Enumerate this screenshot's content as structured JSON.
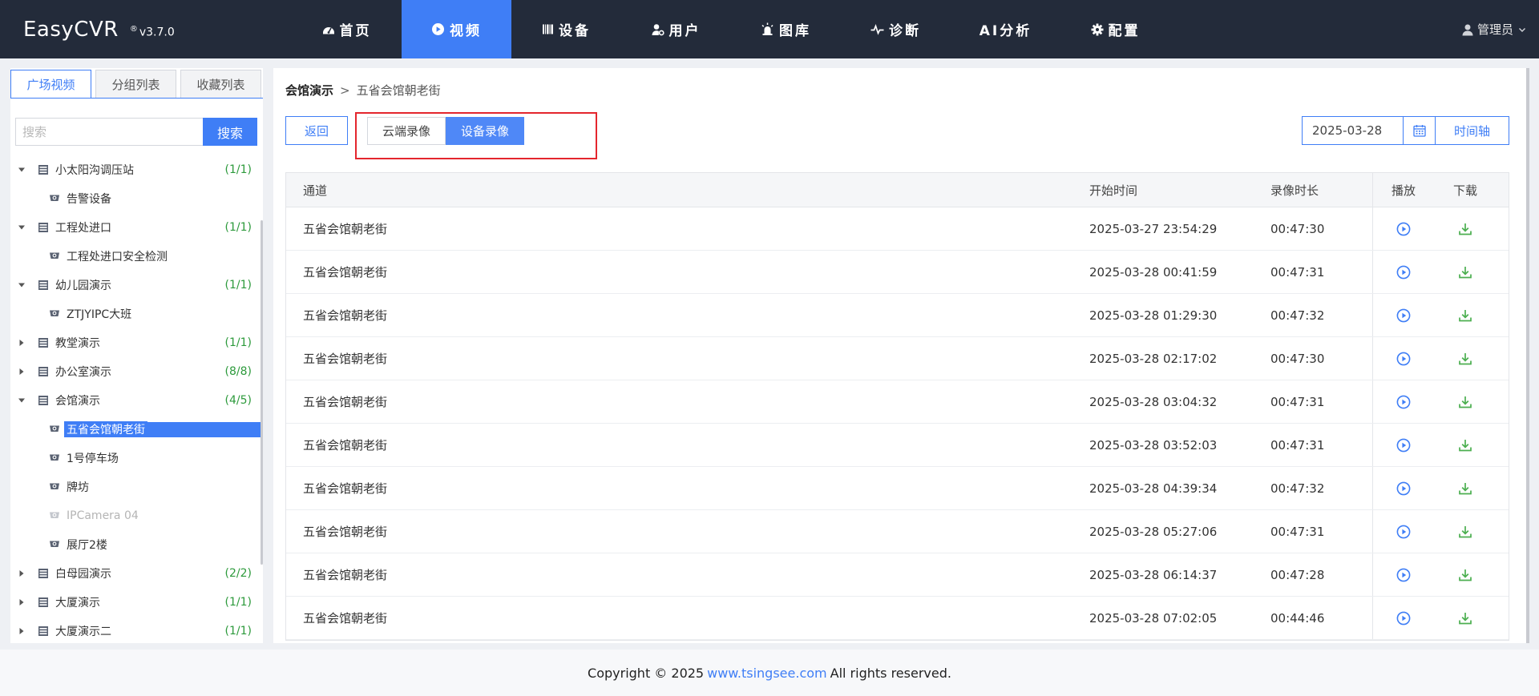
{
  "app": {
    "name": "EasyCVR",
    "version_mark": "®",
    "version": "v3.7.0"
  },
  "nav": [
    {
      "label": "首页",
      "icon": "dashboard-icon"
    },
    {
      "label": "视频",
      "icon": "play-circle-icon",
      "active": true
    },
    {
      "label": "设备",
      "icon": "barcode-icon"
    },
    {
      "label": "用户",
      "icon": "user-cog-icon"
    },
    {
      "label": "图库",
      "icon": "alarm-icon"
    },
    {
      "label": "诊断",
      "icon": "pulse-icon"
    },
    {
      "label": "AI分析",
      "icon": ""
    },
    {
      "label": "配置",
      "icon": "gear-icon"
    }
  ],
  "user": {
    "name": "管理员"
  },
  "sidebar": {
    "tabs": [
      "广场视频",
      "分组列表",
      "收藏列表"
    ],
    "search_placeholder": "搜索",
    "search_button": "搜索",
    "tree": [
      {
        "type": "group",
        "label": "小太阳沟调压站",
        "count": "(1/1)",
        "expanded": true
      },
      {
        "type": "cam",
        "label": "告警设备"
      },
      {
        "type": "group",
        "label": "工程处进口",
        "count": "(1/1)",
        "expanded": true
      },
      {
        "type": "cam",
        "label": "工程处进口安全检测"
      },
      {
        "type": "group",
        "label": "幼儿园演示",
        "count": "(1/1)",
        "expanded": true
      },
      {
        "type": "cam",
        "label": "ZTJYIPC大班"
      },
      {
        "type": "group",
        "label": "教堂演示",
        "count": "(1/1)",
        "expanded": false
      },
      {
        "type": "group",
        "label": "办公室演示",
        "count": "(8/8)",
        "expanded": false
      },
      {
        "type": "group",
        "label": "会馆演示",
        "count": "(4/5)",
        "expanded": true
      },
      {
        "type": "cam",
        "label": "五省会馆朝老街",
        "selected": true
      },
      {
        "type": "cam",
        "label": "1号停车场"
      },
      {
        "type": "cam",
        "label": "牌坊"
      },
      {
        "type": "cam",
        "label": "IPCamera 04",
        "offline": true
      },
      {
        "type": "cam",
        "label": "展厅2楼"
      },
      {
        "type": "group",
        "label": "白母园演示",
        "count": "(2/2)",
        "expanded": false
      },
      {
        "type": "group",
        "label": "大厦演示",
        "count": "(1/1)",
        "expanded": false
      },
      {
        "type": "group",
        "label": "大厦演示二",
        "count": "(1/1)",
        "expanded": false
      }
    ]
  },
  "main": {
    "breadcrumb": {
      "parent": "会馆演示",
      "separator": ">",
      "current": "五省会馆朝老街"
    },
    "back_button": "返回",
    "segments": [
      {
        "label": "云端录像"
      },
      {
        "label": "设备录像",
        "active": true
      }
    ],
    "date_value": "2025-03-28",
    "timeline_button": "时间轴",
    "table": {
      "headers": {
        "channel": "通道",
        "start": "开始时间",
        "duration": "录像时长",
        "play": "播放",
        "download": "下载"
      },
      "rows": [
        {
          "channel": "五省会馆朝老街",
          "start": "2025-03-27 23:54:29",
          "duration": "00:47:30"
        },
        {
          "channel": "五省会馆朝老街",
          "start": "2025-03-28 00:41:59",
          "duration": "00:47:31"
        },
        {
          "channel": "五省会馆朝老街",
          "start": "2025-03-28 01:29:30",
          "duration": "00:47:32"
        },
        {
          "channel": "五省会馆朝老街",
          "start": "2025-03-28 02:17:02",
          "duration": "00:47:30"
        },
        {
          "channel": "五省会馆朝老街",
          "start": "2025-03-28 03:04:32",
          "duration": "00:47:31"
        },
        {
          "channel": "五省会馆朝老街",
          "start": "2025-03-28 03:52:03",
          "duration": "00:47:31"
        },
        {
          "channel": "五省会馆朝老街",
          "start": "2025-03-28 04:39:34",
          "duration": "00:47:32"
        },
        {
          "channel": "五省会馆朝老街",
          "start": "2025-03-28 05:27:06",
          "duration": "00:47:31"
        },
        {
          "channel": "五省会馆朝老街",
          "start": "2025-03-28 06:14:37",
          "duration": "00:47:28"
        },
        {
          "channel": "五省会馆朝老街",
          "start": "2025-03-28 07:02:05",
          "duration": "00:44:46"
        }
      ]
    }
  },
  "footer": {
    "prefix": "Copyright © 2025",
    "link": "www.tsingsee.com",
    "suffix": "All rights reserved."
  },
  "colors": {
    "accent": "#3f7ef6",
    "nav_bg": "#232b3a",
    "count_green": "#2d9a3c",
    "download_green": "#4caf50",
    "highlight_red": "#e4262d"
  }
}
